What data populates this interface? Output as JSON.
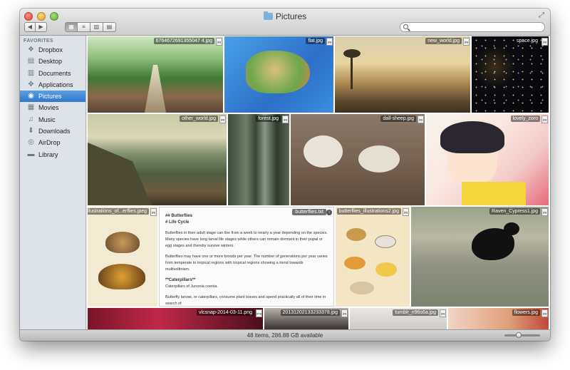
{
  "window": {
    "title": "Pictures"
  },
  "toolbar": {
    "back_label": "◀",
    "forward_label": "▶",
    "views": [
      "icon-view",
      "list-view",
      "column-view",
      "coverflow-view"
    ],
    "search_placeholder": ""
  },
  "sidebar": {
    "heading": "FAVORITES",
    "items": [
      {
        "label": "Dropbox",
        "icon": "dropbox-icon"
      },
      {
        "label": "Desktop",
        "icon": "desktop-icon"
      },
      {
        "label": "Documents",
        "icon": "documents-icon"
      },
      {
        "label": "Applications",
        "icon": "applications-icon"
      },
      {
        "label": "Pictures",
        "icon": "pictures-icon",
        "selected": true
      },
      {
        "label": "Movies",
        "icon": "movies-icon"
      },
      {
        "label": "Music",
        "icon": "music-icon"
      },
      {
        "label": "Downloads",
        "icon": "downloads-icon"
      },
      {
        "label": "AirDrop",
        "icon": "airdrop-icon"
      },
      {
        "label": "Library",
        "icon": "library-icon"
      }
    ],
    "selected_color": "#3b82d6"
  },
  "files": [
    {
      "name": "6764672691355047 4.jpg",
      "ext": "jpg"
    },
    {
      "name": "flat.jpg",
      "ext": "jpg"
    },
    {
      "name": "new_world.jpg",
      "ext": "jpg"
    },
    {
      "name": "space.jpg",
      "ext": "jpg"
    },
    {
      "name": "other_world.jpg",
      "ext": "jpg"
    },
    {
      "name": "forest.jpg",
      "ext": "jpg"
    },
    {
      "name": "dall-sheep.jpg",
      "ext": "jpg"
    },
    {
      "name": "lovely_zoro",
      "ext": "jpg"
    },
    {
      "name": "illustrations_of...erflies.jpeg",
      "ext": "jpg"
    },
    {
      "name": "butterflies.txt",
      "ext": "txt"
    },
    {
      "name": "butterflies_illustrations2.jpg",
      "ext": "jpg"
    },
    {
      "name": "Raven_Cypress1.jpg",
      "ext": "jpg"
    },
    {
      "name": "vlcsnap-2014-03-11.png",
      "ext": "png"
    },
    {
      "name": "20131202133233378.jpg",
      "ext": "jpg"
    },
    {
      "name": "tumblr_n96s6a.jpg",
      "ext": "jpg"
    },
    {
      "name": "flowers.jpg",
      "ext": "jpg"
    }
  ],
  "document": {
    "heading1": "## Butterflies",
    "heading2": "# Life Cycle",
    "para1": "Butterflies in their adult stage can live from a week to nearly a year depending on the species. Many species have long larval life stages while others can remain dormant in their pupal or egg stages and thereby survive winters.",
    "para2": "Butterflies may have one or more broods per year. The number of generations per year varies from temperate to tropical regions with tropical regions showing a trend towards multivoltinism.",
    "heading3": "**Caterpillars**",
    "para3": "Caterpillars of Junonia coenia.",
    "para4": "Butterfly larvae, or caterpillars, consume plant leaves and spend practically all of their time in search of"
  },
  "status": {
    "text": "48 items, 286.88 GB available"
  }
}
